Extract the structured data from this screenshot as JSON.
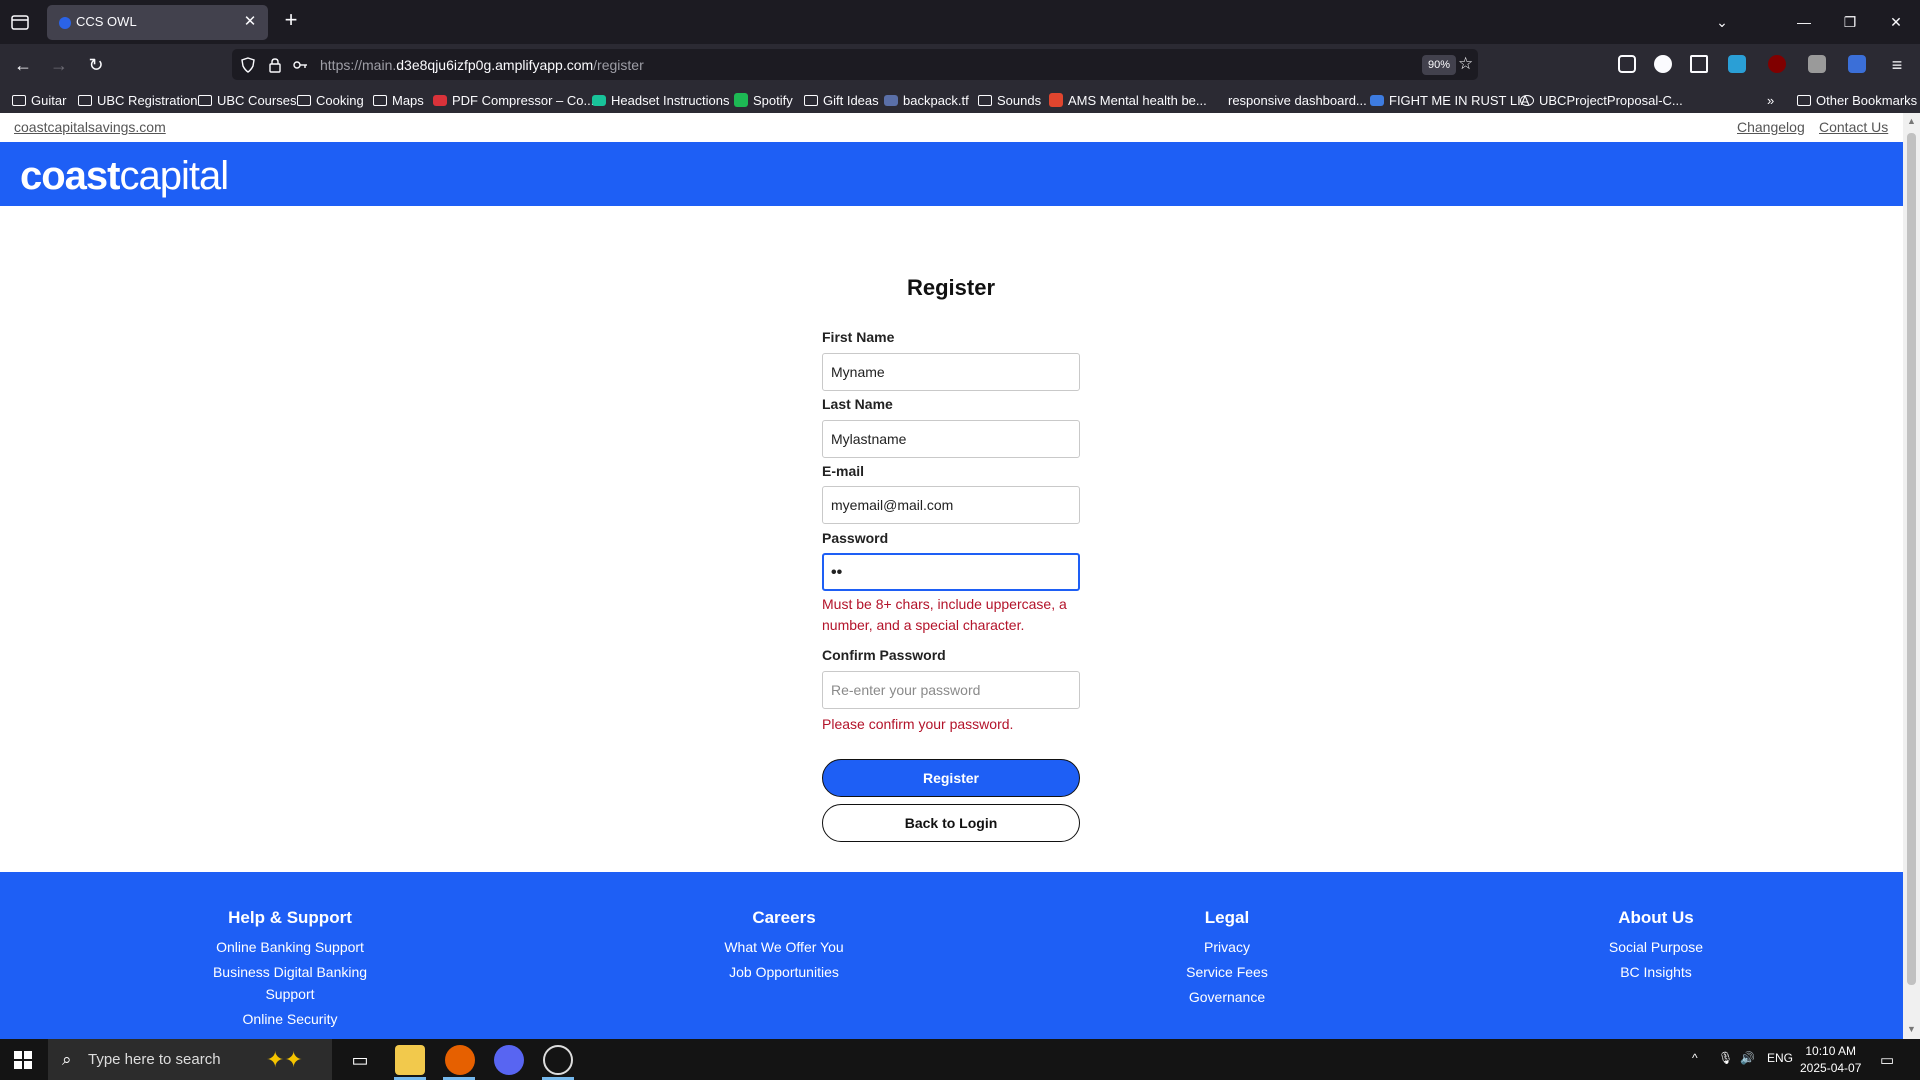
{
  "browser": {
    "tab_title": "CCS OWL",
    "url_prefix": "https://main.",
    "url_host": "d3e8qju6izfp0g.amplifyapp.com",
    "url_path": "/register",
    "zoom": "90%",
    "bookmarks": [
      "Guitar",
      "UBC Registration",
      "UBC Courses",
      "Cooking",
      "Maps",
      "PDF Compressor – Co...",
      "Headset Instructions",
      "Spotify",
      "Gift Ideas",
      "backpack.tf",
      "Sounds",
      "AMS Mental health be...",
      "responsive dashboard...",
      "FIGHT ME IN RUST LIA",
      "UBCProjectProposal-C..."
    ],
    "other_bookmarks": "Other Bookmarks"
  },
  "site": {
    "top_link": "coastcapitalsavings.com",
    "changelog": "Changelog",
    "contact": "Contact Us",
    "logo_bold": "coast",
    "logo_light": "capital"
  },
  "form": {
    "title": "Register",
    "first_name_label": "First Name",
    "first_name_value": "Myname",
    "last_name_label": "Last Name",
    "last_name_value": "Mylastname",
    "email_label": "E-mail",
    "email_value": "myemail@mail.com",
    "password_label": "Password",
    "password_value": "••",
    "password_error": "Must be 8+ chars, include uppercase, a number, and a special character.",
    "confirm_label": "Confirm Password",
    "confirm_placeholder": "Re-enter your password",
    "confirm_error": "Please confirm your password.",
    "register_button": "Register",
    "back_button": "Back to Login"
  },
  "footer": {
    "help": {
      "title": "Help & Support",
      "links": [
        "Online Banking Support",
        "Business Digital Banking Support",
        "Online Security"
      ]
    },
    "careers": {
      "title": "Careers",
      "links": [
        "What We Offer You",
        "Job Opportunities"
      ]
    },
    "legal": {
      "title": "Legal",
      "links": [
        "Privacy",
        "Service Fees",
        "Governance"
      ]
    },
    "about": {
      "title": "About Us",
      "links": [
        "Social Purpose",
        "BC Insights"
      ]
    }
  },
  "taskbar": {
    "search_placeholder": "Type here to search",
    "language": "ENG",
    "time": "10:10 AM",
    "date": "2025-04-07"
  },
  "colors": {
    "brand_blue": "#1e5ff5",
    "error_red": "#b3132a"
  }
}
